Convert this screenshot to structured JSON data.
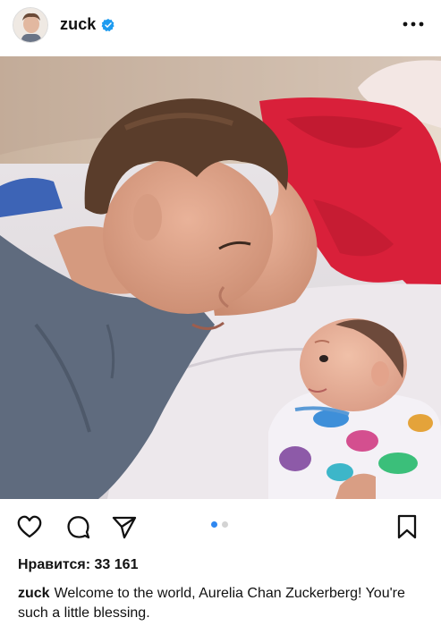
{
  "post": {
    "username": "zuck",
    "verified": true,
    "likes_label": "Нравится: 33 161",
    "caption_user": "zuck",
    "caption_text": "Welcome to the world, Aurelia Chan Zuckerberg! You're such a little blessing.",
    "carousel": {
      "total": 2,
      "current": 1
    }
  },
  "icons": {
    "more": "more-options-icon",
    "like": "heart-icon",
    "comment": "comment-icon",
    "share": "send-icon",
    "save": "bookmark-icon",
    "verified": "verified-badge-icon"
  },
  "colors": {
    "accent": "#2e87f0",
    "verified": "#1d9bf0",
    "text": "#111111"
  }
}
